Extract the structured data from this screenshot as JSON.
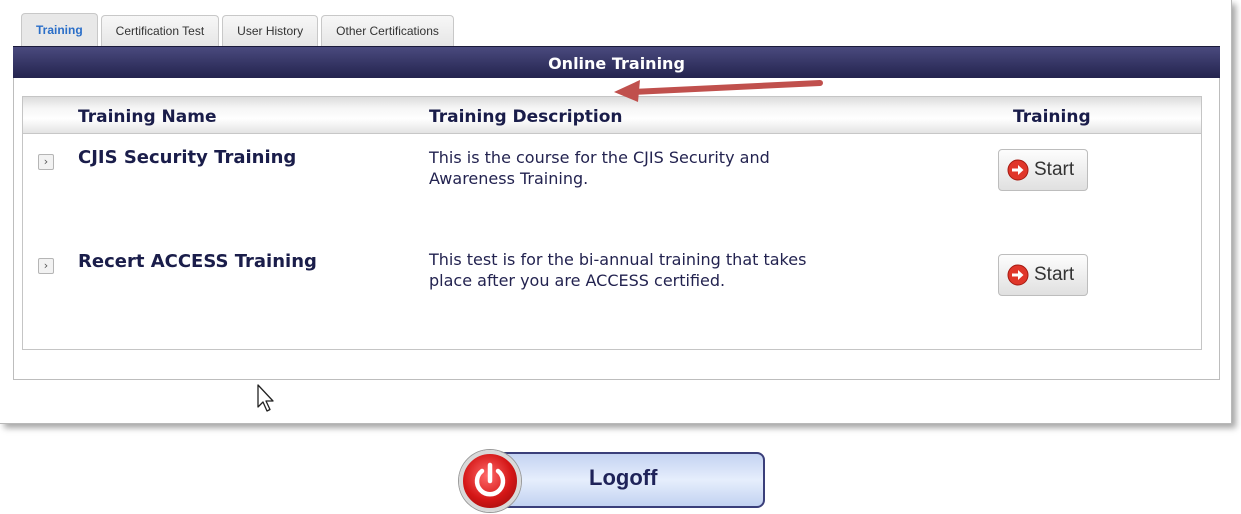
{
  "tabs": [
    {
      "label": "Training",
      "active": true
    },
    {
      "label": "Certification Test",
      "active": false
    },
    {
      "label": "User History",
      "active": false
    },
    {
      "label": "Other Certifications",
      "active": false
    }
  ],
  "header": {
    "title": "Online Training"
  },
  "grid": {
    "columns": [
      "Training Name",
      "Training Description",
      "Training"
    ],
    "rows": [
      {
        "name": "CJIS Security Training",
        "desc1": "This is the course for the CJIS Security and",
        "desc2": "Awareness Training.",
        "action": "Start"
      },
      {
        "name": "Recert ACCESS Training",
        "desc1": "This test is for the bi-annual training that takes",
        "desc2": "place after you are ACCESS certified.",
        "action": "Start"
      }
    ]
  },
  "logoff": {
    "label": "Logoff"
  },
  "colors": {
    "header_bar": "#2c2c5a",
    "active_tab_text": "#2a6ec8",
    "annotation_arrow": "#c0504d",
    "text_navy": "#1a1d4a"
  },
  "icons": {
    "expander": "chevron-right-icon",
    "start": "arrow-right-circle-icon",
    "logoff": "power-icon"
  }
}
